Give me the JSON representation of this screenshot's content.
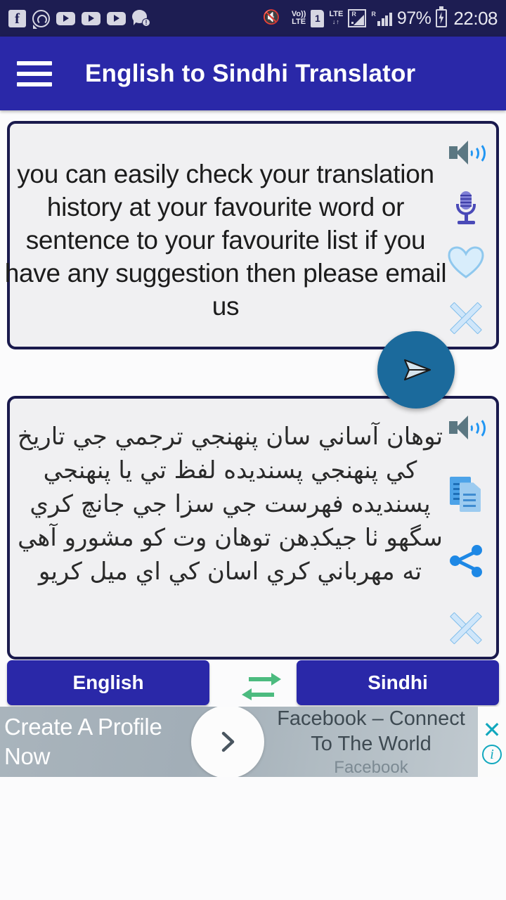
{
  "statusbar": {
    "notification_icons": [
      "facebook-icon",
      "whatsapp-icon",
      "youtube-icon",
      "youtube-icon",
      "youtube-icon",
      "message-alert-icon"
    ],
    "message_badge": "!",
    "vibrate_muted": "muted-vibrate-icon",
    "volte_line1": "Vo))",
    "volte_line2": "LTE",
    "sim_slot": "1",
    "lte_label": "LTE",
    "lte_arrows": "↓↑",
    "roaming_letter": "R",
    "signal_roaming_letter": "R",
    "battery_percent": "97%",
    "battery_state": "charging",
    "clock": "22:08"
  },
  "appbar": {
    "menu_icon": "hamburger-icon",
    "title": "English to Sindhi Translator"
  },
  "input_card": {
    "text": "you can easily check your translation history at your favourite word or sentence to your favourite list if you have any suggestion then please email us",
    "actions": [
      {
        "name": "speak-icon",
        "label": "Speak"
      },
      {
        "name": "microphone-icon",
        "label": "Voice input"
      },
      {
        "name": "favourite-heart-icon",
        "label": "Favourite"
      },
      {
        "name": "clear-x-icon",
        "label": "Clear"
      }
    ]
  },
  "translate_button": {
    "icon": "send-icon",
    "label": "Translate"
  },
  "output_card": {
    "text": "توهان آساني سان پنهنجي ترجمي جي تاريخ كي پنهنجي پسنديده لفظ تي يا پنهنجي پسنديده فهرست جي سزا جي جانچ كري سگهو ٺا جيكڊهن توهان وت كو مشورو آهي ته مهرباني كري اسان كي اي ميل كريو",
    "actions": [
      {
        "name": "speak-icon",
        "label": "Speak"
      },
      {
        "name": "copy-icon",
        "label": "Copy"
      },
      {
        "name": "share-icon",
        "label": "Share"
      },
      {
        "name": "clear-x-icon",
        "label": "Clear"
      }
    ]
  },
  "language_bar": {
    "source_label": "English",
    "target_label": "Sindhi",
    "swap_icon": "swap-arrows-icon",
    "swap_color": "#4CBB7F",
    "button_color": "#2A28A8"
  },
  "ad": {
    "headline": "Create A Profile Now",
    "cta_icon": "chevron-right-icon",
    "title": "Facebook – Connect To The World",
    "advertiser": "Facebook",
    "close_label": "✕",
    "info_label": "i"
  },
  "colors": {
    "statusbar": "#1D1D52",
    "appbar": "#2A28A8",
    "card_border": "#1A1A4D",
    "card_fill": "#F0F0F2",
    "fab": "#1B6A9C",
    "ad_accent": "#12A8BE"
  }
}
